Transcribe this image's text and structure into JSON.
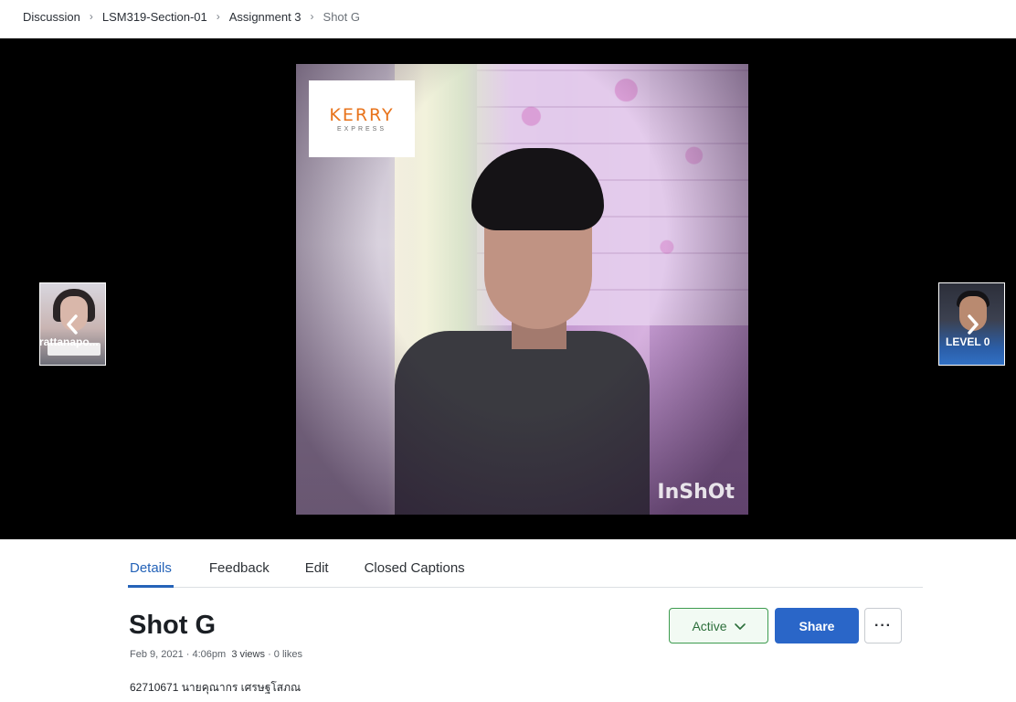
{
  "breadcrumb": {
    "items": [
      "Discussion",
      "LSM319-Section-01",
      "Assignment 3"
    ],
    "current": "Shot G"
  },
  "player": {
    "video_logo": "KERRY",
    "video_logo_sub": "EXPRESS",
    "watermark": "InShOt",
    "prev": {
      "label": "rattanapo..."
    },
    "next": {
      "label": "LEVEL 0"
    }
  },
  "tabs": [
    {
      "label": "Details",
      "active": true
    },
    {
      "label": "Feedback",
      "active": false
    },
    {
      "label": "Edit",
      "active": false
    },
    {
      "label": "Closed Captions",
      "active": false
    }
  ],
  "detail": {
    "title": "Shot G",
    "date": "Feb 9, 2021 · 4:06pm",
    "views": "3 views",
    "likes": "· 0 likes",
    "description": "62710671 นายคุณากร เศรษฐโสภณ"
  },
  "actions": {
    "status_label": "Active",
    "share_label": "Share",
    "more_label": "···"
  },
  "colors": {
    "accent": "#2a66c8",
    "active_status_border": "#3d9b4f",
    "stage_bg": "#000000",
    "logo_orange": "#e8731b"
  },
  "icons": {
    "breadcrumb_separator": "chevron-right-icon",
    "prev": "chevron-left-icon",
    "next": "chevron-right-icon",
    "status_dropdown": "chevron-down-icon",
    "more": "more-horizontal-icon"
  }
}
